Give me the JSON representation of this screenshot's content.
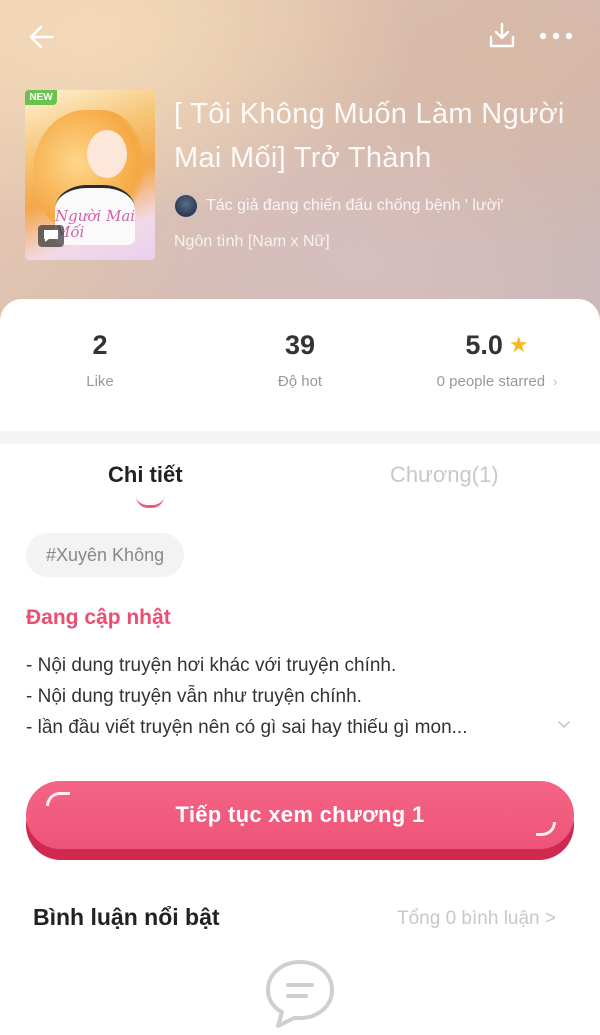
{
  "header": {
    "cover_badge": "NEW",
    "cover_title": "Người Mai Mối",
    "title": "[ Tôi Không Muốn Làm Người Mai Mối] Trở Thành",
    "author": "Tác giả đang chiến đấu chống bệnh ' lười'",
    "genre": "Ngôn tình [Nam x Nữ]"
  },
  "stats": {
    "likes": "2",
    "likes_label": "Like",
    "hot": "39",
    "hot_label": "Độ hot",
    "rating": "5.0",
    "rating_label": "0 people starred"
  },
  "tabs": {
    "detail": "Chi tiết",
    "chapters": "Chương(1)"
  },
  "tag": "#Xuyên Không",
  "status": "Đang cập nhật",
  "description": [
    "- Nội dung truyện hơi khác với truyện chính.",
    "- Nội dung truyện vẫn như truyện chính.",
    "- lần đầu viết truyện nên có gì sai hay thiếu gì mon..."
  ],
  "cta_label": "Tiếp tục xem chương 1",
  "comments": {
    "title": "Bình luận nổi bật",
    "total": "Tổng 0 bình luận >"
  },
  "colors": {
    "accent": "#ee5478",
    "status": "#ec4d72",
    "star": "#f6b723"
  }
}
